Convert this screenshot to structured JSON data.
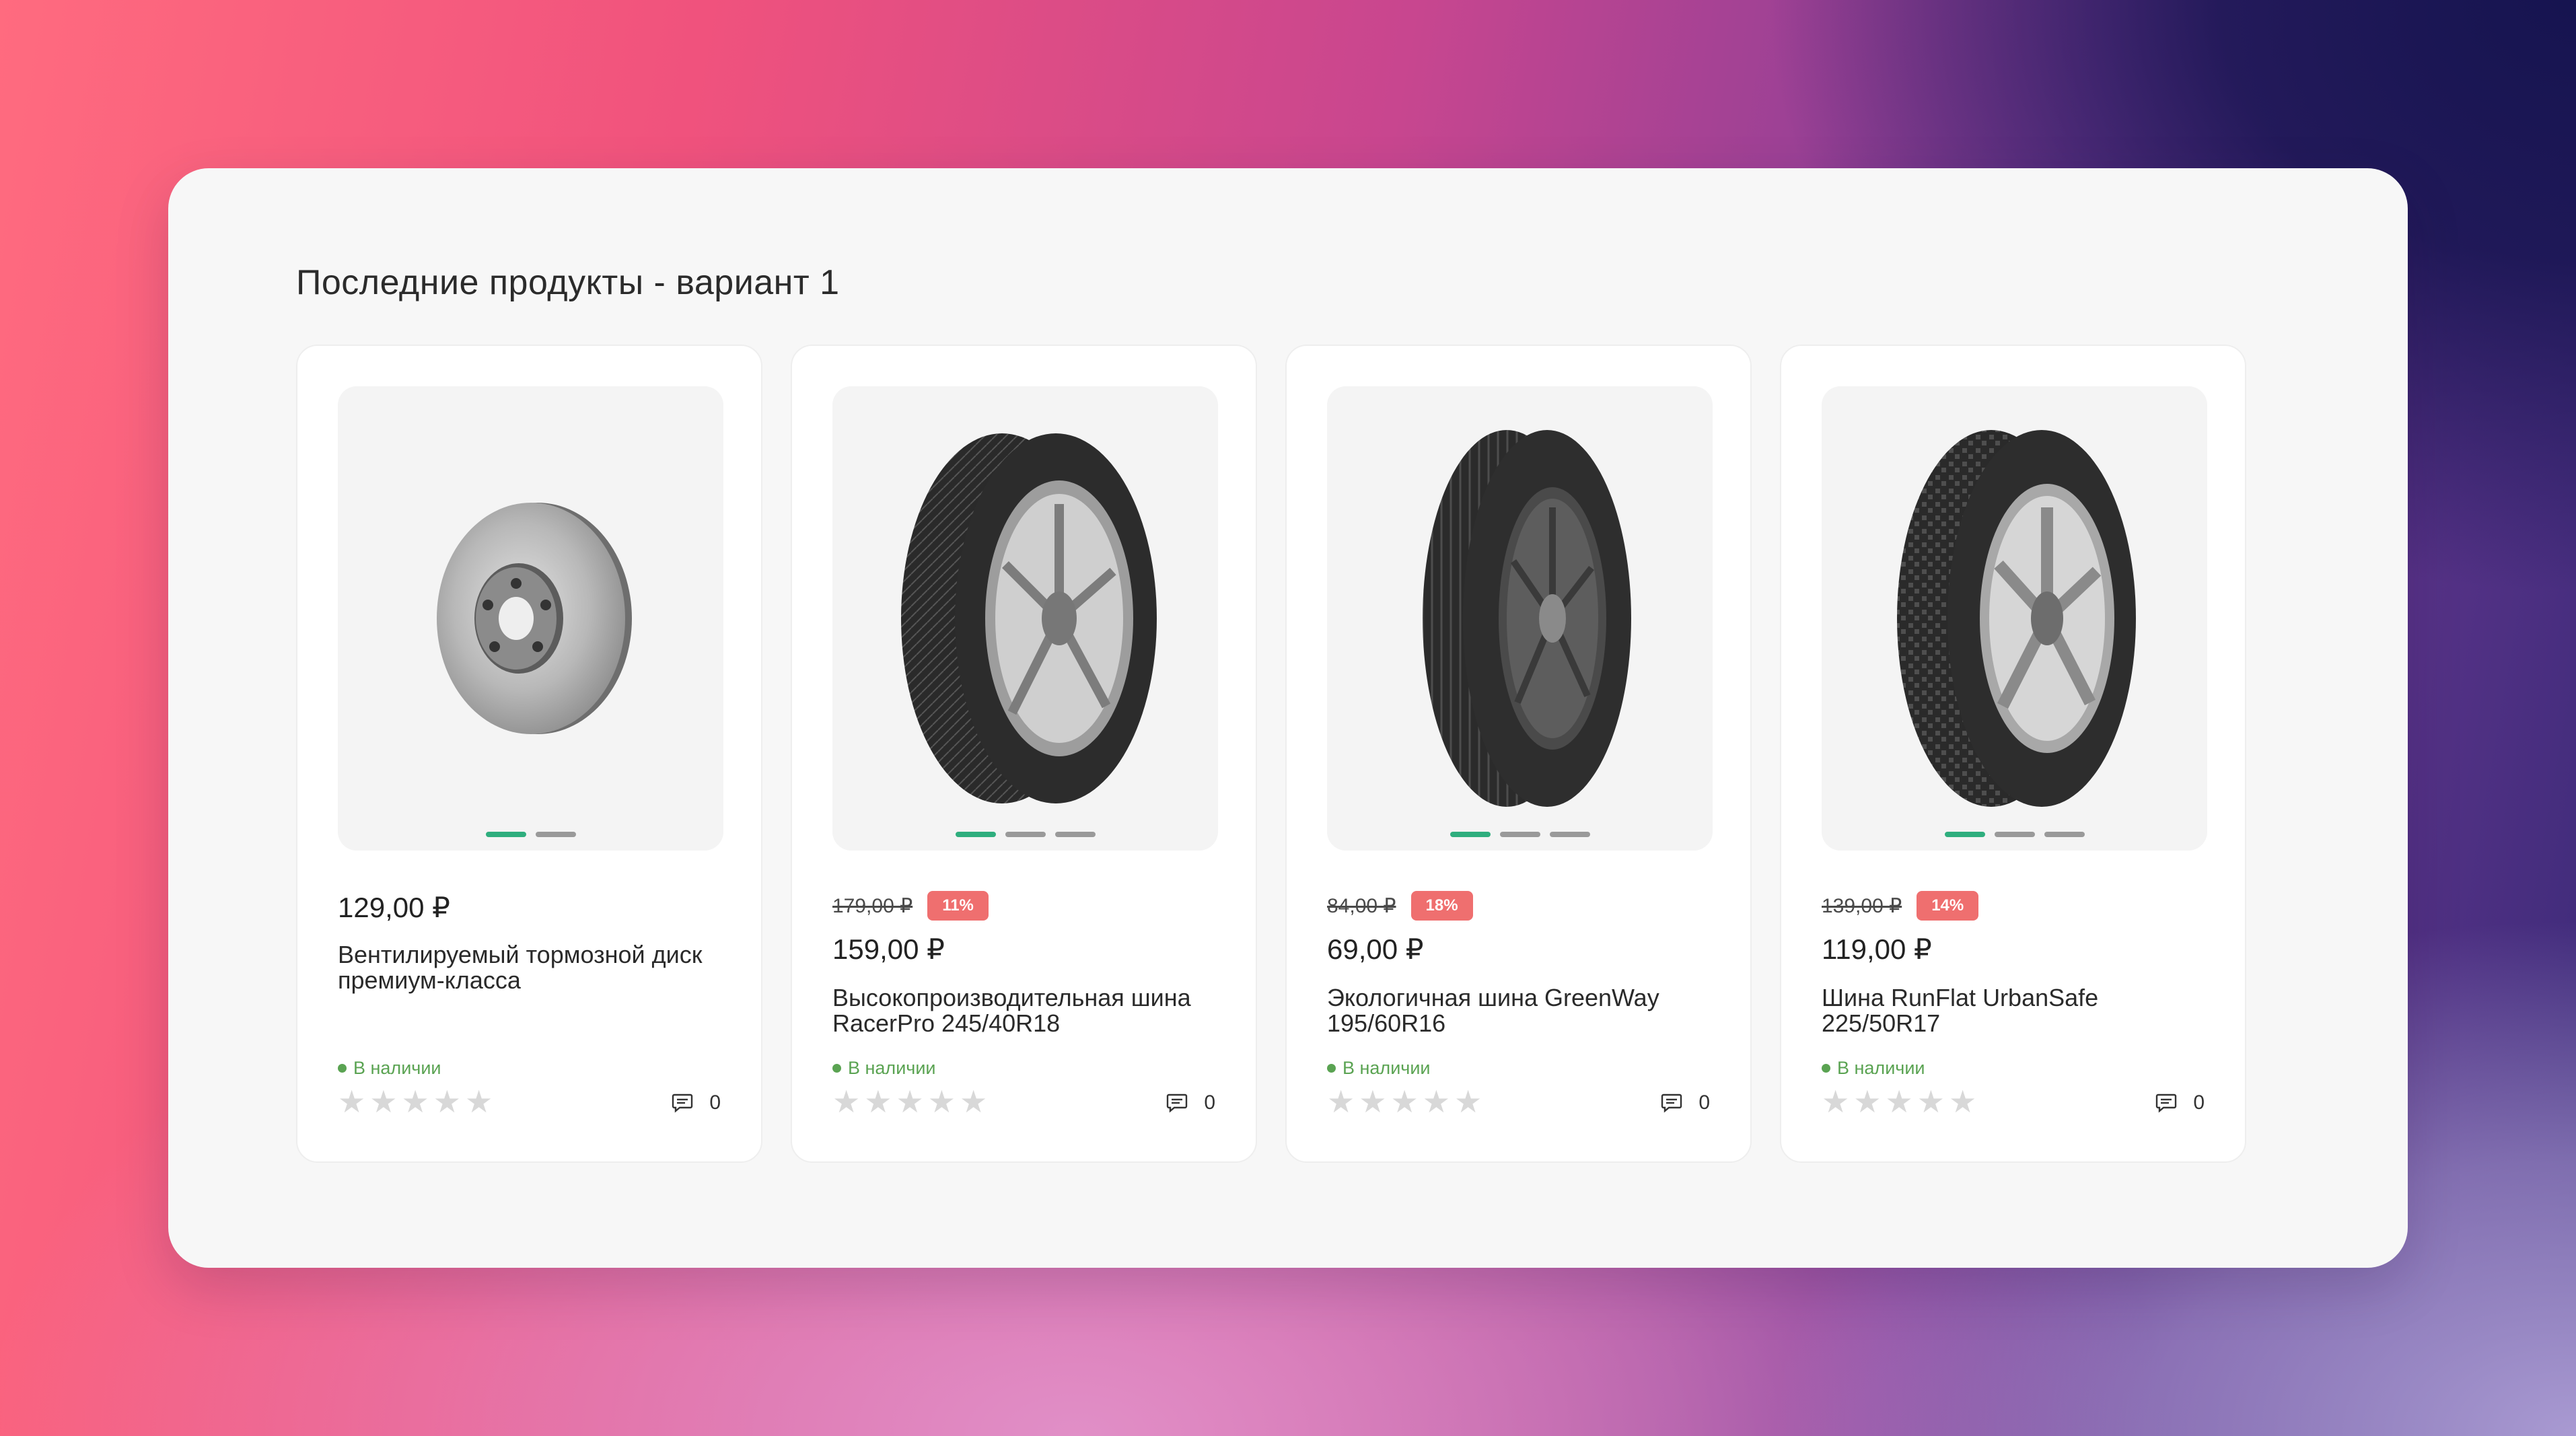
{
  "section_title": "Последние продукты - вариант 1",
  "products": [
    {
      "image": "brake-disc",
      "price": "129,00 ₽",
      "old_price": "",
      "discount": "",
      "name": "Вентилируемый тормозной диск премиум-класса",
      "stock": "В наличии",
      "comments": "0",
      "rating": 0,
      "image_dots": 2
    },
    {
      "image": "tire",
      "price": "159,00 ₽",
      "old_price": "179,00 ₽",
      "discount": "11%",
      "name": "Высокопроизводительная шина RacerPro 245/40R18",
      "stock": "В наличии",
      "comments": "0",
      "rating": 0,
      "image_dots": 3
    },
    {
      "image": "tire",
      "price": "69,00 ₽",
      "old_price": "84,00 ₽",
      "discount": "18%",
      "name": "Экологичная шина GreenWay 195/60R16",
      "stock": "В наличии",
      "comments": "0",
      "rating": 0,
      "image_dots": 3
    },
    {
      "image": "tire",
      "price": "119,00 ₽",
      "old_price": "139,00 ₽",
      "discount": "14%",
      "name": "Шина RunFlat UrbanSafe 225/50R17",
      "stock": "В наличии",
      "comments": "0",
      "rating": 0,
      "image_dots": 3
    }
  ],
  "colors": {
    "accent_green": "#2fae7e",
    "discount_red": "#ef6f6f",
    "stock_green": "#5aa352"
  }
}
